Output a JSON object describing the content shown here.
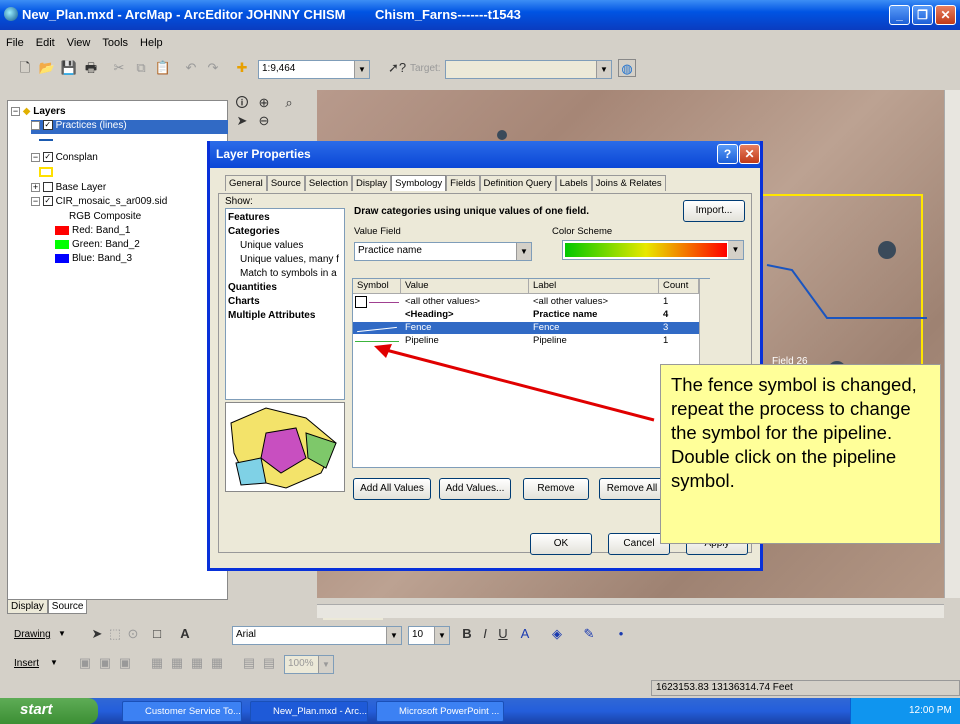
{
  "window": {
    "title": "New_Plan.mxd - ArcMap - ArcEditor",
    "user": "JOHNNY CHISM",
    "doc": "Chism_Farns-------t1543"
  },
  "menu": [
    "File",
    "Edit",
    "View",
    "Tools",
    "Help"
  ],
  "toolbar": {
    "scale": "1:9,464",
    "target_label": "Target:"
  },
  "toc": {
    "layers_label": "Layers",
    "items": [
      {
        "label": "Practices (lines)"
      },
      {
        "label": "Consplan"
      },
      {
        "label": "Base Layer"
      },
      {
        "label": "CIR_mosaic_s_ar009.sid"
      },
      {
        "label": "RGB Composite"
      }
    ],
    "bands": [
      {
        "label": "Red:   Band_1",
        "color": "#ff0000"
      },
      {
        "label": "Green: Band_2",
        "color": "#00ff00"
      },
      {
        "label": "Blue:   Band_3",
        "color": "#0000ff"
      }
    ],
    "tabs": [
      "Display",
      "Source"
    ]
  },
  "map": {
    "field_label": "Field 26"
  },
  "dialog": {
    "title": "Layer Properties",
    "tabs": [
      "General",
      "Source",
      "Selection",
      "Display",
      "Symbology",
      "Fields",
      "Definition Query",
      "Labels",
      "Joins & Relates"
    ],
    "show_label": "Show:",
    "show_items": [
      "Features",
      "Categories",
      "Unique values",
      "Unique values, many f",
      "Match to symbols in a",
      "Quantities",
      "Charts",
      "Multiple Attributes"
    ],
    "heading": "Draw categories using unique values of one field.",
    "import_label": "Import...",
    "value_field_label": "Value Field",
    "value_field": "Practice name",
    "color_scheme_label": "Color Scheme",
    "columns": [
      "Symbol",
      "Value",
      "Label",
      "Count"
    ],
    "rows": [
      {
        "value": "<all other values>",
        "label": "<all other values>",
        "count": "1"
      },
      {
        "value": "<Heading>",
        "label": "Practice name",
        "count": "4"
      },
      {
        "value": "Fence",
        "label": "Fence",
        "count": "3"
      },
      {
        "value": "Pipeline",
        "label": "Pipeline",
        "count": "1"
      }
    ],
    "buttons": {
      "add_all": "Add All Values",
      "add": "Add Values...",
      "remove": "Remove",
      "remove_all": "Remove All",
      "ok": "OK",
      "cancel": "Cancel",
      "apply": "Apply"
    }
  },
  "note": "The fence symbol is changed, repeat the process to change the symbol for the pipeline. Double click on the pipeline symbol.",
  "drawing": {
    "label": "Drawing",
    "font": "Arial",
    "size": "10",
    "insert": "Insert",
    "zoom": "100%"
  },
  "status": "1623153.83  13136314.74 Feet",
  "taskbar": {
    "start": "start",
    "tasks": [
      "Customer Service To...",
      "New_Plan.mxd - Arc...",
      "Microsoft PowerPoint ..."
    ],
    "clock": "12:00 PM"
  }
}
